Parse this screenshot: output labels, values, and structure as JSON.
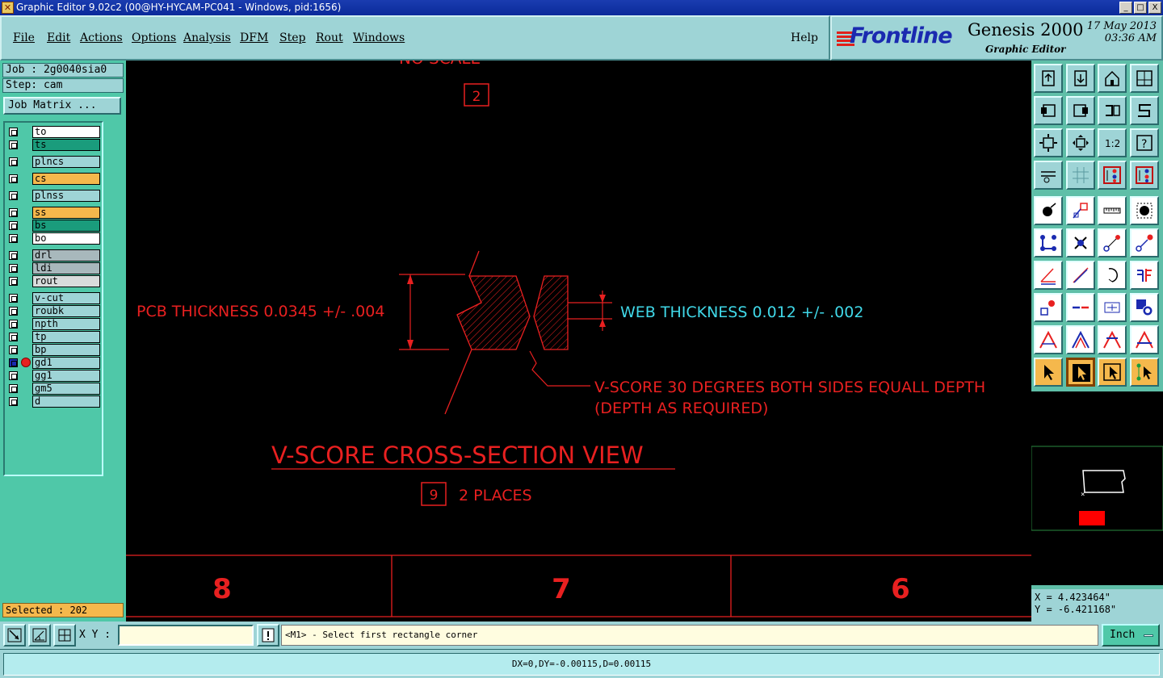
{
  "window": {
    "title": "Graphic Editor 9.02c2 (00@HY-HYCAM-PC041 - Windows, pid:1656)",
    "buttons": [
      "_",
      "□",
      "X"
    ]
  },
  "menu": {
    "items": [
      "File",
      "Edit",
      "Actions",
      "Options",
      "Analysis",
      "DFM",
      "Step",
      "Rout",
      "Windows"
    ],
    "help": "Help"
  },
  "brand": {
    "logo": "Frontline",
    "product": "Genesis 2000",
    "subtitle": "Graphic Editor",
    "date": "17 May 2013",
    "time": "03:36 AM"
  },
  "left": {
    "job": "Job : 2g0040sia0",
    "step": "Step: cam",
    "job_matrix": "Job Matrix ...",
    "selected": "Selected : 202",
    "layers": [
      {
        "name": "to",
        "color": "#ffffff",
        "flag": "✎"
      },
      {
        "name": "ts",
        "color": "#1a9c7c",
        "flag": "✎"
      },
      {
        "name": "plncs",
        "color": "#9ed4d6",
        "flag": ""
      },
      {
        "name": "cs",
        "color": "#f5b84c",
        "flag": "✎"
      },
      {
        "name": "plnss",
        "color": "#9ed4d6",
        "flag": ""
      },
      {
        "name": "ss",
        "color": "#f5b84c",
        "flag": "✎"
      },
      {
        "name": "bs",
        "color": "#1a9c7c",
        "flag": "✎"
      },
      {
        "name": "bo",
        "color": "#ffffff",
        "flag": ""
      },
      {
        "name": "drl",
        "color": "#a8b8bc",
        "flag": ""
      },
      {
        "name": "ldi",
        "color": "#a8b8bc",
        "flag": ""
      },
      {
        "name": "rout",
        "color": "#d8dcdc",
        "flag": ""
      },
      {
        "name": "v-cut",
        "color": "#9ed4d6",
        "flag": ""
      },
      {
        "name": "roubk",
        "color": "#9ed4d6",
        "flag": ""
      },
      {
        "name": "npth",
        "color": "#9ed4d6",
        "flag": ""
      },
      {
        "name": "tp",
        "color": "#9ed4d6",
        "flag": ""
      },
      {
        "name": "bp",
        "color": "#9ed4d6",
        "flag": ""
      },
      {
        "name": "gd1",
        "color": "#9ed4d6",
        "flag": "✎ ⊞"
      },
      {
        "name": "gg1",
        "color": "#9ed4d6",
        "flag": ""
      },
      {
        "name": "gm5",
        "color": "#9ed4d6",
        "flag": "✎"
      },
      {
        "name": "d",
        "color": "#9ed4d6",
        "flag": ""
      }
    ]
  },
  "drawing": {
    "top_text": "NO SCALE",
    "callout_2": "2",
    "pcb_thickness": "PCB THICKNESS 0.0345 +/- .004",
    "web_thickness": "WEB THICKNESS 0.012 +/- .002",
    "vscore_line1": "V-SCORE 30 DEGREES BOTH SIDES EQUALL DEPTH",
    "vscore_line2": "(DEPTH AS REQUIRED)",
    "section_title": "V-SCORE CROSS-SECTION VIEW",
    "callout_9": "9",
    "places": "2 PLACES",
    "zone_numbers": [
      "8",
      "7",
      "6"
    ]
  },
  "right": {
    "coord_x": "X = 4.423464\"",
    "coord_y": "Y = -6.421168\"",
    "tool_icons": [
      "open-step-icon",
      "save-step-icon",
      "home-icon",
      "window-icon",
      "prev-icon",
      "next-icon",
      "swap-icon",
      "snap-icon",
      "zoom-fit-icon",
      "zoom-area-icon",
      "scale-1-2-icon",
      "help-icon",
      "settings-icon",
      "grid-icon",
      "layers-red-icon",
      "layers-blue-icon",
      "pad-icon",
      "line-draw-icon",
      "measure-icon",
      "dot-icon",
      "net-icon",
      "cross-icon",
      "connect-icon",
      "connect-red-icon",
      "angle-icon",
      "slope-icon",
      "arc-icon",
      "split-icon",
      "move-icon",
      "line-cut-icon",
      "snap-center-icon",
      "group-icon",
      "arch-icon",
      "arch-blue-icon",
      "arch-red-icon",
      "arch-red-blue-icon",
      "pointer-icon",
      "pointer-box-icon",
      "pointer-select-icon",
      "pointer-net-icon"
    ]
  },
  "command": {
    "xy_label": "X Y :",
    "xy_value": "",
    "prompt": "<M1> - Select first rectangle corner",
    "units": "Inch"
  },
  "status": {
    "text": "DX=0,DY=-0.00115,D=0.00115"
  },
  "colors": {
    "drawing_red": "#e82020",
    "drawing_cyan": "#40d8e8",
    "panel_teal": "#9ed4d6",
    "panel_green": "#4fc8a8"
  }
}
